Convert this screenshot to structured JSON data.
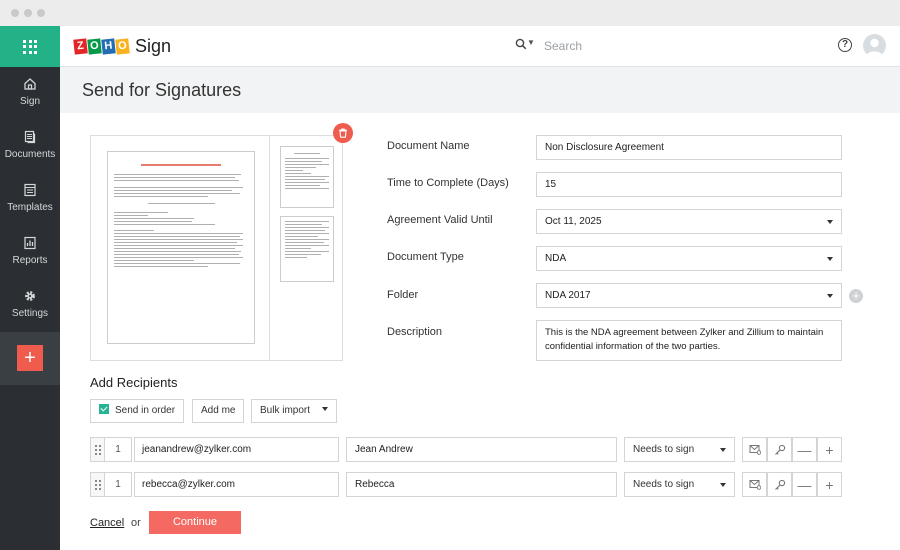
{
  "app": {
    "brand_letters": [
      {
        "char": "Z",
        "color": "#e42527"
      },
      {
        "char": "O",
        "color": "#089949"
      },
      {
        "char": "H",
        "color": "#226db4"
      },
      {
        "char": "O",
        "color": "#f9b21d"
      }
    ],
    "product": "Sign",
    "accent": "#23b288",
    "primary_button_color": "#f46a62"
  },
  "search": {
    "placeholder": "Search"
  },
  "sidebar": {
    "items": [
      {
        "label": "Sign",
        "icon": "home-icon"
      },
      {
        "label": "Documents",
        "icon": "documents-icon"
      },
      {
        "label": "Templates",
        "icon": "templates-icon"
      },
      {
        "label": "Reports",
        "icon": "reports-icon"
      },
      {
        "label": "Settings",
        "icon": "gear-icon"
      }
    ],
    "add_label": "+"
  },
  "page": {
    "title": "Send for Signatures"
  },
  "form": {
    "document_name": {
      "label": "Document Name",
      "value": "Non Disclosure Agreement"
    },
    "time_to_complete": {
      "label": "Time to Complete (Days)",
      "value": "15"
    },
    "valid_until": {
      "label": "Agreement Valid Until",
      "value": "Oct 11, 2025"
    },
    "document_type": {
      "label": "Document Type",
      "value": "NDA"
    },
    "folder": {
      "label": "Folder",
      "value": "NDA 2017"
    },
    "description": {
      "label": "Description",
      "value": "This is the NDA agreement between Zylker and Zillium to maintain confidential information of the two parties."
    }
  },
  "recipients": {
    "title": "Add Recipients",
    "send_in_order": "Send in order",
    "add_me": "Add me",
    "bulk_import": "Bulk import",
    "rows": [
      {
        "order": "1",
        "email": "jeanandrew@zylker.com",
        "name": "Jean Andrew",
        "role": "Needs to sign"
      },
      {
        "order": "1",
        "email": "rebecca@zylker.com",
        "name": "Rebecca",
        "role": "Needs to sign"
      }
    ],
    "remove_label": "—",
    "add_label": "+"
  },
  "footer": {
    "cancel": "Cancel",
    "or": "or",
    "continue": "Continue"
  }
}
